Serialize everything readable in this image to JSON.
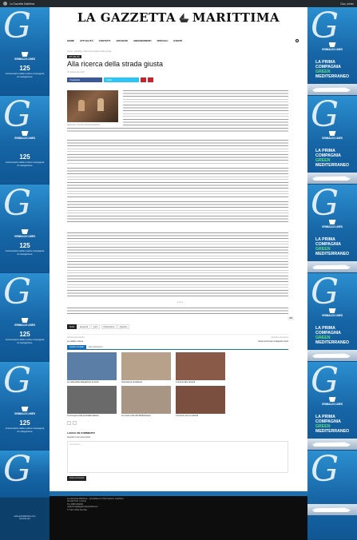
{
  "topbar": {
    "left": "La Gazzetta Marittima",
    "right": "Ciao, admin"
  },
  "masthead": {
    "title_part1": "LA GAZZETTA",
    "title_part2": "MARITTIMA"
  },
  "nav": [
    "HOME",
    "ATTUALITÀ",
    "CONTATTI",
    "ARCHIVIO",
    "ABBONAMENTI",
    "SPECIALI",
    "EVENTI"
  ],
  "breadcrumb": "Home › Attualità › Alla ricerca della strada giusta",
  "article": {
    "category": "ATTUALITÀ",
    "title": "Alla ricerca della strada giusta",
    "date": "23 Settembre 2022",
    "share": {
      "facebook": "f  Facebook",
      "twitter": "Twitter"
    },
    "photo_caption": "Nella foto: l'incontro dell'associazione",
    "divider": "* * *",
    "badge": "484"
  },
  "tags": {
    "label": "TAGS",
    "items": [
      "assoporti",
      "porto",
      "infrastrutture",
      "logistica"
    ]
  },
  "prevnext": {
    "prev_label": "Articolo precedente",
    "prev_title": "Le notizie in breve",
    "next_label": "Articolo successivo",
    "next_title": "Nuovi servizi per il trasporto merci"
  },
  "related": {
    "tabs": [
      "Articoli correlati",
      "Altro dell'autore"
    ],
    "items": [
      {
        "caption": "La visita della delegazione al porto",
        "color": "#5b7ea6"
      },
      {
        "caption": "Intervista al presidente",
        "color": "#b8a18a"
      },
      {
        "caption": "Il premio alla carriera",
        "color": "#8a5a48"
      },
      {
        "caption": "Il convegno sulla portualità italiana",
        "color": "#6b6a6a"
      },
      {
        "caption": "Le nuove rotte del Mediterraneo",
        "color": "#a89584"
      },
      {
        "caption": "L'incontro con le autorità",
        "color": "#7a4f3f"
      }
    ],
    "pager": [
      "‹",
      "›"
    ]
  },
  "comments": {
    "heading": "LASCIA UN COMMENTO",
    "subheading": "Inserisci il tuo commento!",
    "placeholder": "Commento:",
    "submit": "Invia commento"
  },
  "footer": {
    "lines": [
      "La Gazzetta Marittima – Quotidiano di informazione marittima",
      "Via dei Porti, Livorno",
      "Tel. 0586 000000",
      "redazione@lagazzettamarittima.it",
      "© Tutti i diritti riservati"
    ]
  },
  "ads": {
    "brand": "GRIMALDI LINES",
    "number": "125",
    "tagline": "Anniversario della nostra compagnia di navigazione",
    "headline": [
      "LA PRIMA",
      "COMPAGNIA",
      "GREEN",
      "MEDITERRANEO"
    ],
    "footer": [
      "www.grimaldi-lines.com",
      "prenota ora"
    ]
  }
}
